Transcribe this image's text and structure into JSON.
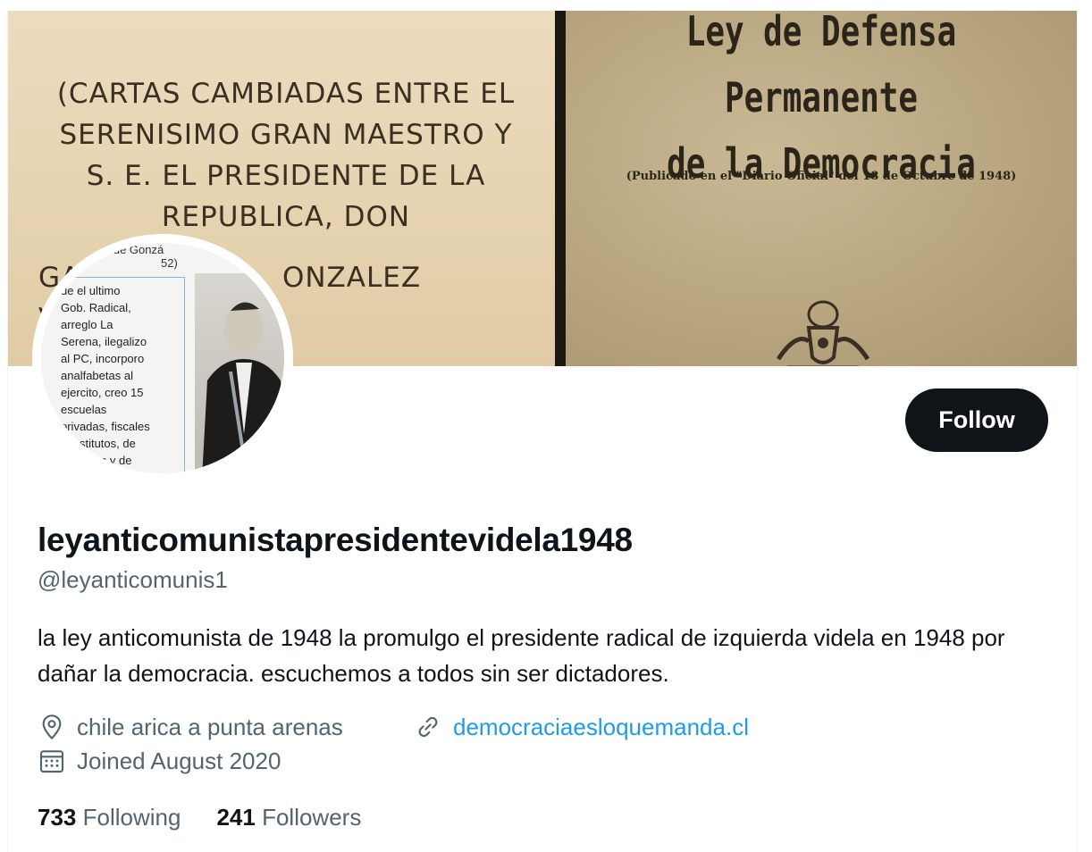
{
  "banner": {
    "left_lines": [
      "(CARTAS CAMBIADAS ENTRE EL",
      "SERENISIMO GRAN MAESTRO Y",
      "S. E. EL PRESIDENTE DE LA",
      "REPUBLICA, DON",
      "GA",
      "ONZALEZ VIDELA)"
    ],
    "right_title_line1": "Ley de Defensa Permanente",
    "right_title_line2": "de la Democracia",
    "right_subtitle": "(Publicado en el \"Diario Oficial\" del 18 de Octubre de 1948)"
  },
  "avatar": {
    "top_text": "e de Gonzá",
    "top_text2": "52)",
    "caption": "ue el ultimo\nGob. Radical,\narreglo La\nSerena,  ilegalizo\nal PC, incorporo\nanalfabetas al\nejercito, creo 15\nescuelas\nprivadas,  fiscales\ne institutos, de\nacitación y de\nnalización"
  },
  "profile": {
    "follow_label": "Follow",
    "display_name": "leyanticomunistapresidentevidela1948",
    "handle": "@leyanticomunis1",
    "bio": "la ley anticomunista de 1948 la promulgo el presidente radical de izquierda videla en 1948 por dañar la democracia. escuchemos a todos sin ser dictadores.",
    "location": "chile arica a punta arenas",
    "url": "democraciaesloquemanda.cl",
    "joined": "Joined August 2020"
  },
  "stats": {
    "following_count": "733",
    "following_label": "Following",
    "followers_count": "241",
    "followers_label": "Followers"
  },
  "colors": {
    "accent": "#1d9bf0",
    "text_primary": "#0f1419",
    "text_secondary": "#536471",
    "button_bg": "#0f1419"
  },
  "icons": {
    "location": "location-pin-icon",
    "url": "link-icon",
    "joined": "calendar-icon"
  }
}
